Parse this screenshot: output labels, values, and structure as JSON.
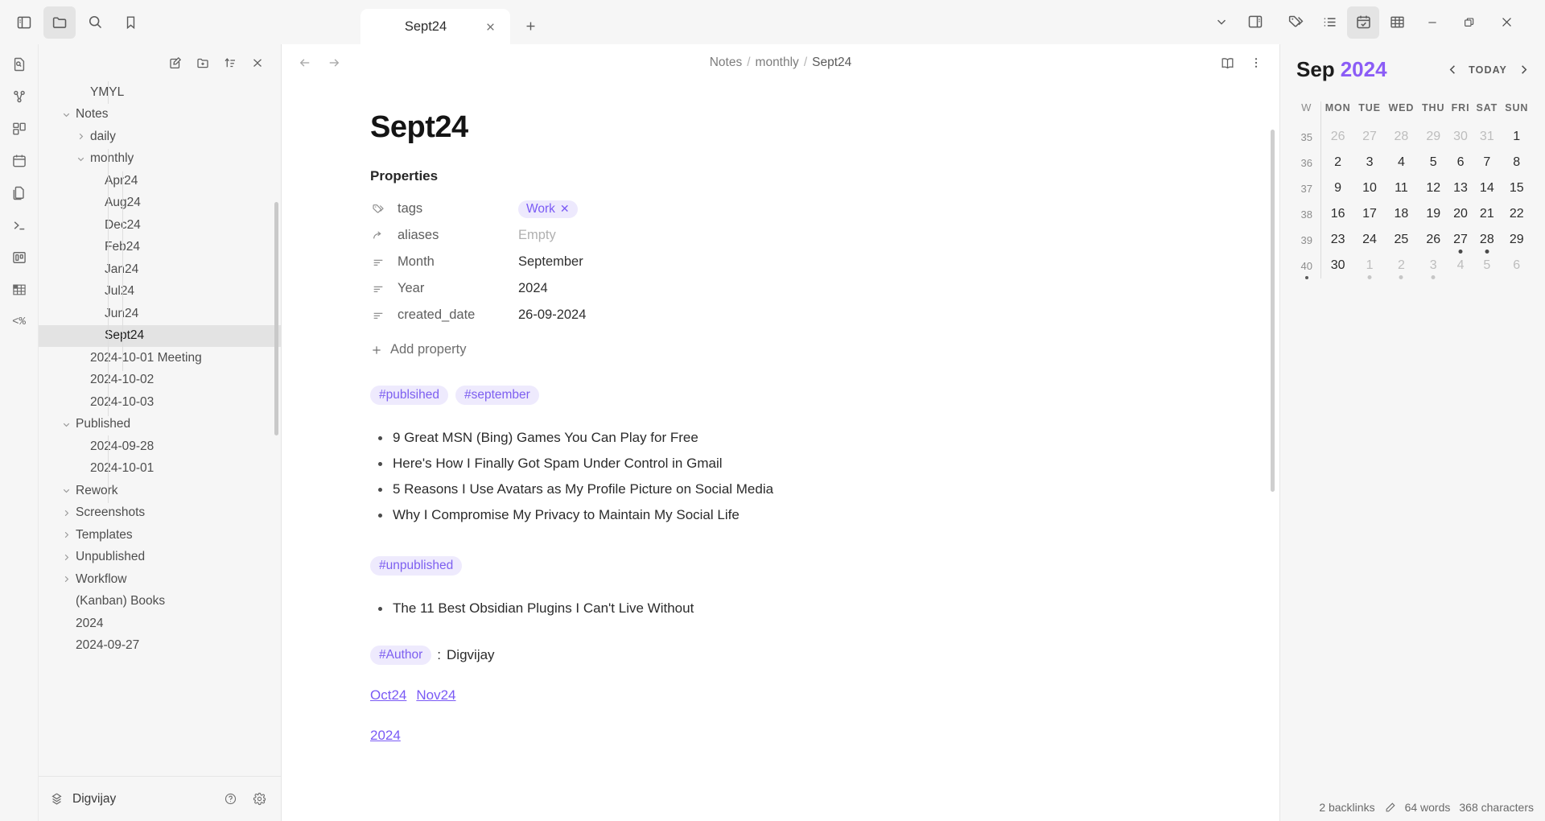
{
  "window": {
    "tab_title": "Sept24",
    "minimize_label": "Minimize",
    "restore_label": "Restore",
    "close_label": "Close"
  },
  "topbar": {
    "left_icons": [
      {
        "name": "toggle-left-sidebar-icon",
        "label": "Toggle left sidebar"
      },
      {
        "name": "folder-icon",
        "label": "Files",
        "active": true
      },
      {
        "name": "search-icon",
        "label": "Search"
      },
      {
        "name": "bookmark-icon",
        "label": "Bookmarks"
      }
    ],
    "center_right_icons": [
      {
        "name": "chevron-down-icon",
        "label": "Tab list"
      },
      {
        "name": "toggle-right-sidebar-icon",
        "label": "Toggle right sidebar"
      }
    ],
    "right_icons": [
      {
        "name": "tags-icon",
        "label": "Tags"
      },
      {
        "name": "outline-icon",
        "label": "Outline"
      },
      {
        "name": "calendar-icon",
        "label": "Calendar",
        "active": true
      },
      {
        "name": "table-icon",
        "label": "Table"
      }
    ]
  },
  "ribbon": {
    "items": [
      {
        "name": "file-search-icon",
        "label": "Quick switcher"
      },
      {
        "name": "graph-view-icon",
        "label": "Graph view"
      },
      {
        "name": "canvas-icon",
        "label": "Canvas"
      },
      {
        "name": "calendar-icon",
        "label": "Calendar"
      },
      {
        "name": "copy-files-icon",
        "label": "Templates"
      },
      {
        "name": "terminal-icon",
        "label": "Terminal"
      },
      {
        "name": "kanban-icon",
        "label": "Kanban"
      },
      {
        "name": "spreadsheet-icon",
        "label": "Spreadsheet"
      },
      {
        "name": "code-template-icon",
        "label": "Templater"
      }
    ],
    "code_label": "<%"
  },
  "explorer": {
    "toolbar": [
      {
        "name": "new-note-icon",
        "label": "New note"
      },
      {
        "name": "new-folder-icon",
        "label": "New folder"
      },
      {
        "name": "sort-icon",
        "label": "Change sort order"
      },
      {
        "name": "collapse-all-icon",
        "label": "Collapse all"
      }
    ],
    "tree": [
      {
        "label": "YMYL",
        "depth": 2,
        "type": "file",
        "chev": "none"
      },
      {
        "label": "Notes",
        "depth": 1,
        "type": "folder",
        "chev": "down"
      },
      {
        "label": "daily",
        "depth": 2,
        "type": "folder",
        "chev": "right"
      },
      {
        "label": "monthly",
        "depth": 2,
        "type": "folder",
        "chev": "down"
      },
      {
        "label": "Apr24",
        "depth": 3,
        "type": "file",
        "chev": "none"
      },
      {
        "label": "Aug24",
        "depth": 3,
        "type": "file",
        "chev": "none"
      },
      {
        "label": "Dec24",
        "depth": 3,
        "type": "file",
        "chev": "none"
      },
      {
        "label": "Feb24",
        "depth": 3,
        "type": "file",
        "chev": "none"
      },
      {
        "label": "Jan24",
        "depth": 3,
        "type": "file",
        "chev": "none"
      },
      {
        "label": "Jul24",
        "depth": 3,
        "type": "file",
        "chev": "none"
      },
      {
        "label": "Jun24",
        "depth": 3,
        "type": "file",
        "chev": "none"
      },
      {
        "label": "Sept24",
        "depth": 3,
        "type": "file",
        "chev": "none",
        "selected": true
      },
      {
        "label": "2024-10-01 Meeting",
        "depth": 2,
        "type": "file",
        "chev": "none"
      },
      {
        "label": "2024-10-02",
        "depth": 2,
        "type": "file",
        "chev": "none"
      },
      {
        "label": "2024-10-03",
        "depth": 2,
        "type": "file",
        "chev": "none"
      },
      {
        "label": "Published",
        "depth": 1,
        "type": "folder",
        "chev": "down"
      },
      {
        "label": "2024-09-28",
        "depth": 2,
        "type": "file",
        "chev": "none"
      },
      {
        "label": "2024-10-01",
        "depth": 2,
        "type": "file",
        "chev": "none"
      },
      {
        "label": "Rework",
        "depth": 1,
        "type": "folder",
        "chev": "down"
      },
      {
        "label": "Screenshots",
        "depth": 1,
        "type": "folder",
        "chev": "right"
      },
      {
        "label": "Templates",
        "depth": 1,
        "type": "folder",
        "chev": "right"
      },
      {
        "label": "Unpublished",
        "depth": 1,
        "type": "folder",
        "chev": "right"
      },
      {
        "label": "Workflow",
        "depth": 1,
        "type": "folder",
        "chev": "right"
      },
      {
        "label": "(Kanban) Books",
        "depth": 1,
        "type": "file",
        "chev": "none"
      },
      {
        "label": "2024",
        "depth": 1,
        "type": "file",
        "chev": "none"
      },
      {
        "label": "2024-09-27",
        "depth": 1,
        "type": "file",
        "chev": "none"
      }
    ],
    "vault": {
      "name": "Digvijay",
      "help_label": "Help",
      "settings_label": "Settings"
    }
  },
  "editor": {
    "back_label": "Back",
    "forward_label": "Forward",
    "breadcrumb": [
      "Notes",
      "monthly",
      "Sept24"
    ],
    "actions": [
      {
        "name": "reading-view-icon",
        "label": "Reading view"
      },
      {
        "name": "more-options-icon",
        "label": "More options"
      }
    ],
    "title": "Sept24",
    "properties_heading": "Properties",
    "properties": [
      {
        "icon": "tag-icon",
        "key": "tags",
        "value": "Work",
        "type": "pill"
      },
      {
        "icon": "alias-icon",
        "key": "aliases",
        "value": "Empty",
        "type": "empty"
      },
      {
        "icon": "text-icon",
        "key": "Month",
        "value": "September",
        "type": "text"
      },
      {
        "icon": "text-icon",
        "key": "Year",
        "value": "2024",
        "type": "text"
      },
      {
        "icon": "text-icon",
        "key": "created_date",
        "value": "26-09-2024",
        "type": "text"
      }
    ],
    "add_property_label": "Add property",
    "tags_published": [
      "#publsihed",
      "#september"
    ],
    "published_items": [
      "9 Great MSN (Bing) Games You Can Play for Free",
      "Here's How I Finally Got Spam Under Control in Gmail",
      "5 Reasons I Use Avatars as My Profile Picture on Social Media",
      "Why I Compromise My Privacy to Maintain My Social Life"
    ],
    "tag_unpublished": "#unpublished",
    "unpublished_items": [
      "The 11 Best Obsidian Plugins I Can't Live Without"
    ],
    "tag_author": "#Author",
    "author_separator": ": ",
    "author_name": "Digvijay",
    "month_links": [
      "Oct24",
      "Nov24"
    ],
    "year_link": "2024"
  },
  "calendar": {
    "month": "Sep",
    "year": "2024",
    "prev_label": "Previous month",
    "next_label": "Next month",
    "today_label": "TODAY",
    "headers": [
      "W",
      "MON",
      "TUE",
      "WED",
      "THU",
      "FRI",
      "SAT",
      "SUN"
    ],
    "weeks": [
      {
        "w": "35",
        "wdot": false,
        "days": [
          {
            "d": "26",
            "muted": true
          },
          {
            "d": "27",
            "muted": true
          },
          {
            "d": "28",
            "muted": true
          },
          {
            "d": "29",
            "muted": true
          },
          {
            "d": "30",
            "muted": true
          },
          {
            "d": "31",
            "muted": true
          },
          {
            "d": "1",
            "muted": false
          }
        ]
      },
      {
        "w": "36",
        "wdot": false,
        "days": [
          {
            "d": "2"
          },
          {
            "d": "3"
          },
          {
            "d": "4"
          },
          {
            "d": "5"
          },
          {
            "d": "6"
          },
          {
            "d": "7"
          },
          {
            "d": "8"
          }
        ]
      },
      {
        "w": "37",
        "wdot": false,
        "days": [
          {
            "d": "9"
          },
          {
            "d": "10"
          },
          {
            "d": "11"
          },
          {
            "d": "12"
          },
          {
            "d": "13"
          },
          {
            "d": "14"
          },
          {
            "d": "15"
          }
        ]
      },
      {
        "w": "38",
        "wdot": false,
        "days": [
          {
            "d": "16"
          },
          {
            "d": "17"
          },
          {
            "d": "18"
          },
          {
            "d": "19"
          },
          {
            "d": "20"
          },
          {
            "d": "21"
          },
          {
            "d": "22"
          }
        ]
      },
      {
        "w": "39",
        "wdot": false,
        "days": [
          {
            "d": "23"
          },
          {
            "d": "24"
          },
          {
            "d": "25"
          },
          {
            "d": "26"
          },
          {
            "d": "27",
            "dot": true
          },
          {
            "d": "28",
            "dot": true
          },
          {
            "d": "29"
          }
        ]
      },
      {
        "w": "40",
        "wdot": true,
        "days": [
          {
            "d": "30"
          },
          {
            "d": "1",
            "muted": true,
            "dot": true
          },
          {
            "d": "2",
            "muted": true,
            "dot": true
          },
          {
            "d": "3",
            "muted": true,
            "dot": true
          },
          {
            "d": "4",
            "muted": true
          },
          {
            "d": "5",
            "muted": true
          },
          {
            "d": "6",
            "muted": true
          }
        ]
      }
    ]
  },
  "statusbar": {
    "backlinks": "2 backlinks",
    "edit_icon": "pencil-icon",
    "words": "64 words",
    "characters": "368 characters"
  }
}
